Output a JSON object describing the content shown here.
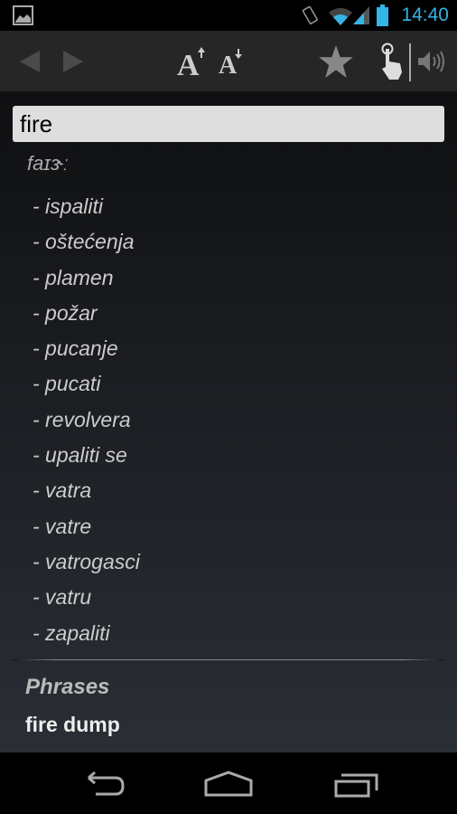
{
  "status_bar": {
    "time": "14:40",
    "icons": [
      "gallery-icon",
      "vibrate-icon",
      "wifi-icon",
      "signal-icon",
      "battery-icon"
    ]
  },
  "toolbar": {
    "buttons": [
      "back-arrow-icon",
      "forward-arrow-icon",
      "font-increase-icon",
      "font-decrease-icon",
      "star-icon",
      "touch-icon",
      "speaker-icon"
    ]
  },
  "search": {
    "value": "fire"
  },
  "entry": {
    "phonetic": "faɪɝː",
    "translations": [
      "- ispaliti",
      "- oštećenja",
      "- plamen",
      "- požar",
      "- pucanje",
      "- pucati",
      "- revolvera",
      "- upaliti se",
      "- vatra",
      "- vatre",
      "- vatrogasci",
      "- vatru",
      "- zapaliti"
    ]
  },
  "phrases": {
    "heading": "Phrases",
    "items": [
      "fire dump"
    ]
  },
  "colors": {
    "accent": "#33b5e5",
    "search_bg": "#dedede"
  }
}
